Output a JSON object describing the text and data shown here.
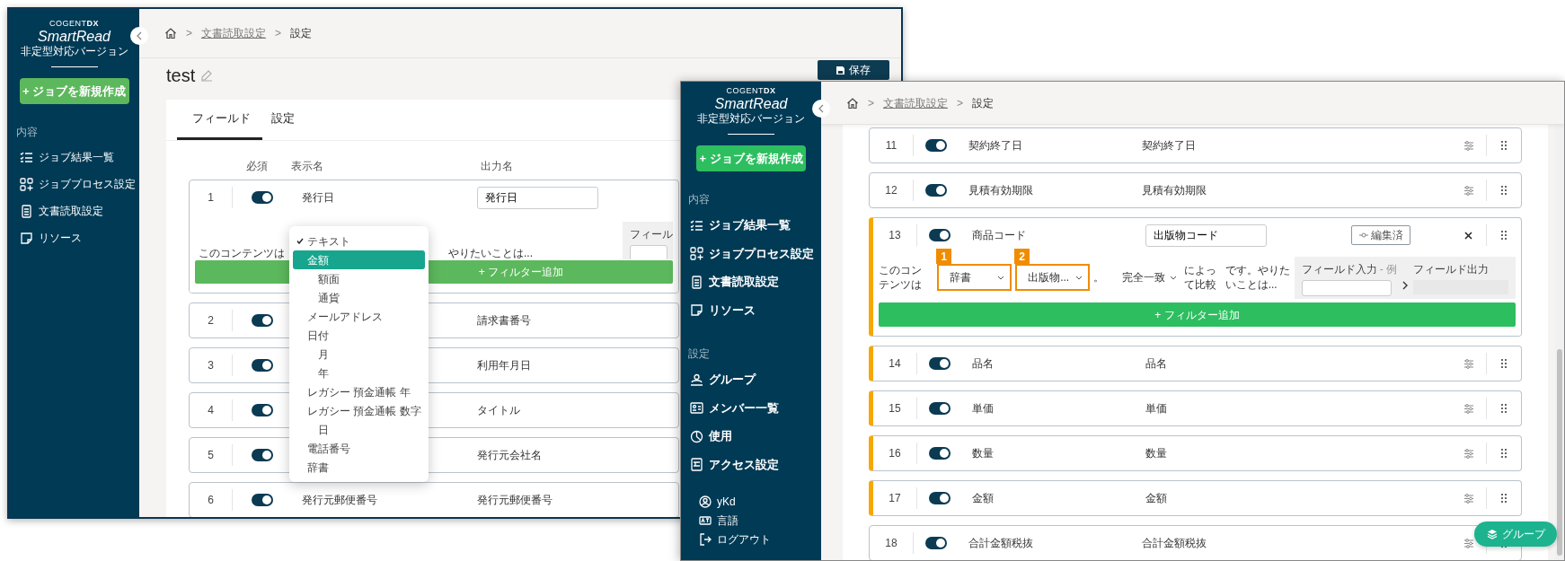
{
  "back_window": {
    "sidebar": {
      "maker": "COGENT**DX**",
      "product": "SmartRead",
      "edition": "非定型対応バージョン",
      "new_job_button": "+ ジョブを新規作成",
      "sections": [
        {
          "title": "内容",
          "items": [
            "ジョブ結果一覧",
            "ジョブプロセス設定",
            "文書読取設定",
            "リソース"
          ]
        }
      ]
    },
    "breadcrumb": [
      {
        "kind": "home"
      },
      {
        "kind": "separator",
        "text": ">"
      },
      {
        "kind": "link",
        "text": "文書読取設定"
      },
      {
        "kind": "separator",
        "text": ">"
      },
      {
        "kind": "current",
        "text": "設定"
      }
    ],
    "title": "test",
    "save_button": "保存",
    "tabs": [
      {
        "label": "フィールド",
        "selected": true
      },
      {
        "label": "設定",
        "selected": false
      }
    ],
    "columns": [
      "必須",
      "表示名",
      "出力名"
    ],
    "rows": [
      {
        "number": "1",
        "required": true,
        "display_name": "発行日",
        "output_name": "発行日",
        "filter": {
          "lead": "このコンテンツは",
          "tail": "やりたいことは...",
          "input_label": "フィール",
          "add_button": "+ フィルター追加"
        }
      },
      {
        "number": "2",
        "required": true,
        "output_name": "請求書番号"
      },
      {
        "number": "3",
        "required": true,
        "output_name": "利用年月日"
      },
      {
        "number": "4",
        "required": true,
        "output_name": "タイトル"
      },
      {
        "number": "5",
        "required": true,
        "output_name": "発行元会社名"
      },
      {
        "number": "6",
        "required": true,
        "display_name": "発行元郵便番号",
        "output_name": "発行元郵便番号"
      }
    ]
  },
  "type_menu": {
    "items": [
      {
        "label": "テキスト",
        "checked": true,
        "selected": false
      },
      {
        "label": "金額",
        "checked": false,
        "selected": true,
        "children": [
          {
            "label": "額面",
            "checked": false,
            "selected": false
          },
          {
            "label": "通貨",
            "checked": false,
            "selected": false
          }
        ]
      },
      {
        "label": "メールアドレス",
        "checked": false,
        "selected": false
      },
      {
        "label": "日付",
        "checked": false,
        "selected": false,
        "children": [
          {
            "label": "月",
            "checked": false,
            "selected": false
          },
          {
            "label": "年",
            "checked": false,
            "selected": false
          }
        ]
      },
      {
        "label": "レガシー 預金通帳 年",
        "checked": false,
        "selected": false
      },
      {
        "label": "レガシー 預金通帳 数字",
        "checked": false,
        "selected": false,
        "children": [
          {
            "label": "日",
            "checked": false,
            "selected": false
          }
        ]
      },
      {
        "label": "電話番号",
        "checked": false,
        "selected": false
      },
      {
        "label": "辞書",
        "checked": false,
        "selected": false
      }
    ]
  },
  "front_window": {
    "sidebar": {
      "maker": "COGENT**DX**",
      "product": "SmartRead",
      "edition": "非定型対応バージョン",
      "new_job_button": "+ ジョブを新規作成",
      "sections": [
        {
          "title": "内容",
          "items": [
            "ジョブ結果一覧",
            "ジョブプロセス設定",
            "文書読取設定",
            "リソース"
          ]
        },
        {
          "title": "設定",
          "items": [
            "グループ",
            "メンバー一覧",
            "使用",
            "アクセス設定"
          ]
        }
      ],
      "footer": [
        "yKd",
        "言語",
        "ログアウト"
      ]
    },
    "breadcrumb": [
      {
        "kind": "home"
      },
      {
        "kind": "separator",
        "text": ">"
      },
      {
        "kind": "link",
        "text": "文書読取設定"
      },
      {
        "kind": "separator",
        "text": ">"
      },
      {
        "kind": "current",
        "text": "設定"
      }
    ],
    "rows": [
      {
        "number": "11",
        "required": true,
        "marked": false,
        "display_name": "契約終了日",
        "output_name": "契約終了日"
      },
      {
        "number": "12",
        "required": true,
        "marked": false,
        "display_name": "見積有効期限",
        "output_name": "見積有効期限"
      },
      {
        "number": "13",
        "required": true,
        "marked": true,
        "display_name": "商品コード",
        "output_name": "出版物コード",
        "edited_button": "編集済",
        "filter": {
          "lead": "このコンテンツは",
          "selects": [
            {
              "badge": "1",
              "value": "辞書"
            },
            {
              "badge": "2",
              "value": "出版物..."
            }
          ],
          "period": "。",
          "match_select": "完全一致",
          "compare_text": "によって比較",
          "tail": "です。やりたいことは...",
          "input_label": "フィールド入力",
          "input_hint": "- 例",
          "output_label": "フィールド出力",
          "add_button": "+ フィルター追加"
        }
      },
      {
        "number": "14",
        "required": true,
        "marked": true,
        "display_name": "品名",
        "output_name": "品名"
      },
      {
        "number": "15",
        "required": true,
        "marked": true,
        "display_name": "単価",
        "output_name": "単価"
      },
      {
        "number": "16",
        "required": true,
        "marked": true,
        "display_name": "数量",
        "output_name": "数量"
      },
      {
        "number": "17",
        "required": true,
        "marked": true,
        "display_name": "金額",
        "output_name": "金額"
      },
      {
        "number": "18",
        "required": true,
        "marked": false,
        "display_name": "合計金額税抜",
        "output_name": "合計金額税抜"
      }
    ]
  },
  "group_button": "グループ"
}
